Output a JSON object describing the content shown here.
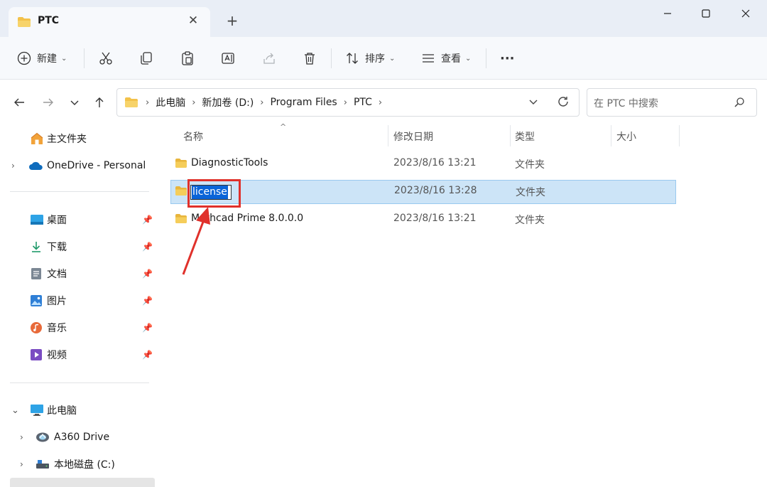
{
  "window": {
    "tab_title": "PTC",
    "tab_close": "✕",
    "new_tab": "+",
    "controls": {
      "minimize": "minimize",
      "maximize": "maximize",
      "close": "close"
    }
  },
  "toolbar": {
    "new_label": "新建",
    "sort_label": "排序",
    "view_label": "查看",
    "more_label": "···",
    "icons": [
      "plus-circle-icon",
      "cut-icon",
      "copy-icon",
      "paste-icon",
      "rename-icon",
      "share-icon",
      "delete-icon"
    ]
  },
  "nav": {
    "breadcrumbs": [
      "此电脑",
      "新加卷 (D:)",
      "Program Files",
      "PTC"
    ],
    "search_placeholder": "在 PTC 中搜索"
  },
  "sidebar": {
    "home": "主文件夹",
    "onedrive": "OneDrive - Personal",
    "quick_access": [
      {
        "label": "桌面",
        "icon": "desktop-icon",
        "color": "#2ea3e6"
      },
      {
        "label": "下载",
        "icon": "download-icon",
        "color": "#1f9a6a"
      },
      {
        "label": "文档",
        "icon": "document-icon",
        "color": "#7b8794"
      },
      {
        "label": "图片",
        "icon": "pictures-icon",
        "color": "#2f7fd6"
      },
      {
        "label": "音乐",
        "icon": "music-icon",
        "color": "#e86a3a"
      },
      {
        "label": "视频",
        "icon": "video-icon",
        "color": "#7a4cc2"
      }
    ],
    "this_pc": "此电脑",
    "drives": [
      "A360 Drive",
      "本地磁盘 (C:)"
    ]
  },
  "content": {
    "columns": [
      "名称",
      "修改日期",
      "类型",
      "大小"
    ],
    "rows": [
      {
        "name": "DiagnosticTools",
        "date": "2023/8/16 13:21",
        "type": "文件夹",
        "selected": false
      },
      {
        "name": "license",
        "date": "2023/8/16 13:28",
        "type": "文件夹",
        "selected": true
      },
      {
        "name": "Mathcad Prime 8.0.0.0",
        "date": "2023/8/16 13:21",
        "type": "文件夹",
        "selected": false
      }
    ]
  },
  "colors": {
    "accent": "#0a64d8",
    "selection": "#cce4f7",
    "annotation": "#e0312b",
    "folder": "#f3c24a"
  }
}
